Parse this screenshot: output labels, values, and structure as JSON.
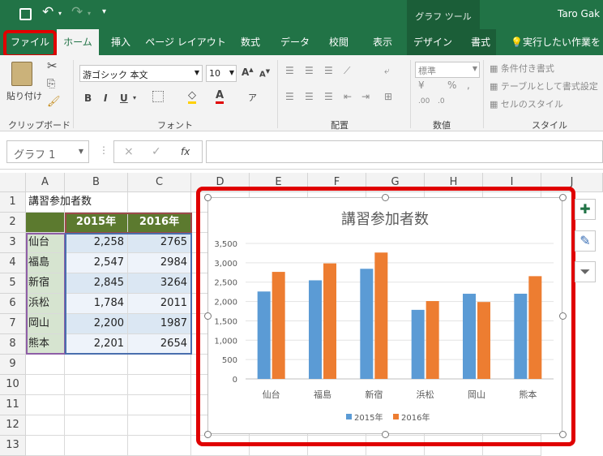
{
  "titlebar": {
    "context": "グラフ ツール",
    "user": "Taro Gak"
  },
  "tabs": [
    "ファイル",
    "ホーム",
    "挿入",
    "ページ レイアウト",
    "数式",
    "データ",
    "校閲",
    "表示",
    "デザイン",
    "書式"
  ],
  "tellme": "実行したい作業を入",
  "ribbon": {
    "paste": "貼り付け",
    "font_name": "游ゴシック 本文",
    "font_size": "10",
    "number_format": "標準",
    "cond_format": "条件付き書式",
    "table_format": "テーブルとして書式設定",
    "cell_style": "セルのスタイル",
    "groups": {
      "clipboard": "クリップボード",
      "font": "フォント",
      "align": "配置",
      "number": "数値",
      "style": "スタイル"
    }
  },
  "formulabar": {
    "namebox": "グラフ 1",
    "fx": "fx",
    "cancel": "×",
    "enter": "✓"
  },
  "columns": [
    "A",
    "B",
    "C",
    "D",
    "E",
    "F",
    "G",
    "H",
    "I",
    "J"
  ],
  "rows": [
    "1",
    "2",
    "3",
    "4",
    "5",
    "6",
    "7",
    "8",
    "9",
    "10",
    "11",
    "12",
    "13"
  ],
  "sheet": {
    "a1": "講習参加者数",
    "h2015": "2015年",
    "h2016": "2016年",
    "data": [
      {
        "city": "仙台",
        "v2015": "2,258",
        "v2016": "2765"
      },
      {
        "city": "福島",
        "v2015": "2,547",
        "v2016": "2984"
      },
      {
        "city": "新宿",
        "v2015": "2,845",
        "v2016": "3264"
      },
      {
        "city": "浜松",
        "v2015": "1,784",
        "v2016": "2011"
      },
      {
        "city": "岡山",
        "v2015": "2,200",
        "v2016": "1987"
      },
      {
        "city": "熊本",
        "v2015": "2,201",
        "v2016": "2654"
      }
    ]
  },
  "chart_data": {
    "type": "bar",
    "title": "講習参加者数",
    "categories": [
      "仙台",
      "福島",
      "新宿",
      "浜松",
      "岡山",
      "熊本"
    ],
    "series": [
      {
        "name": "2015年",
        "values": [
          2258,
          2547,
          2845,
          1784,
          2200,
          2201
        ],
        "color": "#5b9bd5"
      },
      {
        "name": "2016年",
        "values": [
          2765,
          2984,
          3264,
          2011,
          1987,
          2654
        ],
        "color": "#ed7d31"
      }
    ],
    "ylim": [
      0,
      3500
    ],
    "yticks": [
      "0",
      "500",
      "1,000",
      "1,500",
      "2,000",
      "2,500",
      "3,000",
      "3,500"
    ],
    "legend": "bottom",
    "grid": true
  },
  "accent": {
    "excel_green": "#217346",
    "highlight": "#e00000"
  }
}
